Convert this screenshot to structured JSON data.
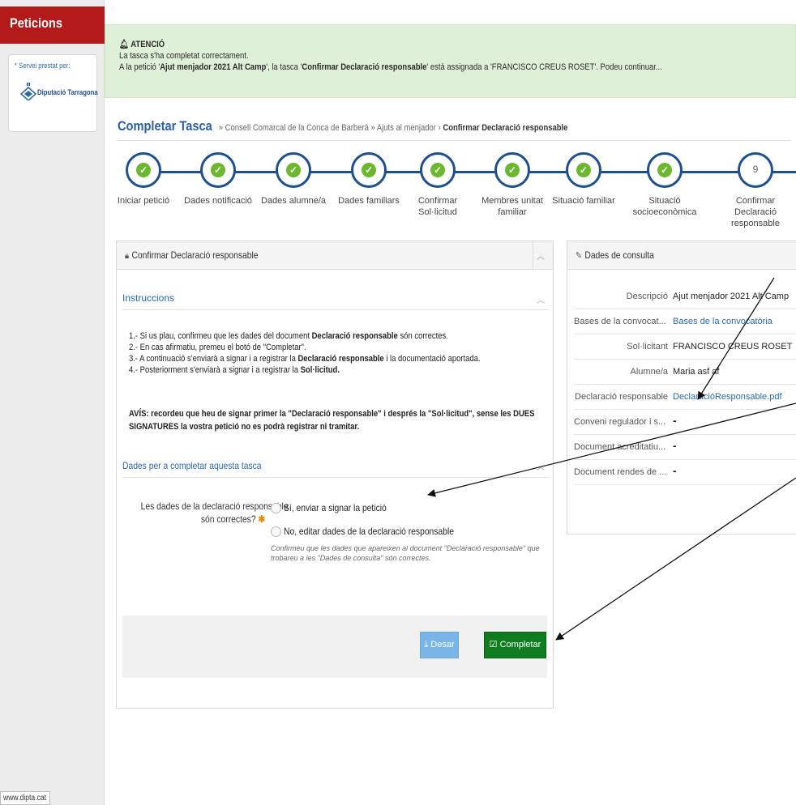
{
  "sidebar": {
    "header": "Peticions",
    "service_label": "* Servei prestat per:",
    "logo_text": "Diputació Tarragona",
    "footer_url": "www.dipta.cat"
  },
  "alert": {
    "title": "ATENCIÓ",
    "line1": "La tasca s'ha completat correctament.",
    "line2_a": "A la petició '",
    "line2_b": "Ajut menjador 2021 Alt Camp",
    "line2_c": "', la tasca '",
    "line2_d": "Confirmar Declaració responsable",
    "line2_e": "' està assignada a 'FRANCISCO CREUS ROSET'. Podeu continuar..."
  },
  "page": {
    "title": "Completar Tasca",
    "breadcrumb_a": "» Consell Comarcal de la Conca de Barberà » Ajuts al menjador ›",
    "breadcrumb_b": "Confirmar Declaració responsable"
  },
  "wizard": {
    "steps": [
      {
        "label": "Iniciar petició",
        "done": true
      },
      {
        "label": "Dades notificació",
        "done": true
      },
      {
        "label": "Dades alumne/a",
        "done": true
      },
      {
        "label": "Dades familiars",
        "done": true
      },
      {
        "label": "Confirmar Sol·licitud",
        "done": true
      },
      {
        "label": "Membres unitat familiar",
        "done": true
      },
      {
        "label": "Situació familiar",
        "done": true
      },
      {
        "label": "Situació socioeconòmica",
        "done": true
      },
      {
        "label": "Confirmar Declaració responsable",
        "done": false,
        "number": "9"
      }
    ]
  },
  "left_panel": {
    "title": "Confirmar Declaració responsable",
    "instructions_title": "Instruccions",
    "instr1_a": "1.- Si us plau, confirmeu que les dades del document ",
    "instr1_b": "Declaració responsable",
    "instr1_c": " són correctes.",
    "instr2": "2.- En cas afirmatiu, premeu el botó de \"Completar\".",
    "instr3_a": "3.- A continuació s'enviarà a signar i a registrar la ",
    "instr3_b": "Declaració responsable",
    "instr3_c": " i la documentació aportada.",
    "instr4_a": "4.- Posteriorment s'enviarà a signar i a registrar la ",
    "instr4_b": "Sol·licitud.",
    "warning_line1": "AVÍS: recordeu que heu de signar primer la \"Declaració responsable\" i després la \"Sol·licitud\", sense les DUES",
    "warning_line2": "SIGNATURES la vostra petició no es podrà registrar ni tramitar.",
    "form_title": "Dades per a completar aquesta tasca",
    "question_line1": "Les dades de la declaració responsable",
    "question_line2": "són correctes?",
    "option_yes": "Sí, enviar a signar la petició",
    "option_no": "No, editar dades de la declaració responsable",
    "help_text": "Confirmeu que les dades que apareixen al document \"Declaració responsable\" que trobareu a les \"Dades de consulta\" són correctes.",
    "save_label": "Desar",
    "complete_label": "Completar"
  },
  "right_panel": {
    "title": "Dades de consulta",
    "rows": [
      {
        "label": "Descripció",
        "value": "Ajut menjador 2021 Alt Camp"
      },
      {
        "label": "Bases de la convocat...",
        "value": "Bases de la convocatòria"
      },
      {
        "label": "Sol·licitant",
        "value": "FRANCISCO CREUS ROSET"
      },
      {
        "label": "Alumne/a",
        "value": "Maria asf af"
      },
      {
        "label": "Declaració responsable",
        "value": "DeclaracióResponsable.pdf"
      },
      {
        "label": "Conveni regulador i s...",
        "value": "-"
      },
      {
        "label": "Document acreditatiu...",
        "value": "-"
      },
      {
        "label": "Document rendes de ...",
        "value": "-"
      }
    ]
  },
  "colors": {
    "brand_red": "#b31a1a",
    "wizard_blue": "#1e4f8f",
    "check_green": "#6bb72d",
    "complete_green": "#0f7c20",
    "save_blue": "#79b5e6",
    "alert_bg": "#dff0d8"
  }
}
